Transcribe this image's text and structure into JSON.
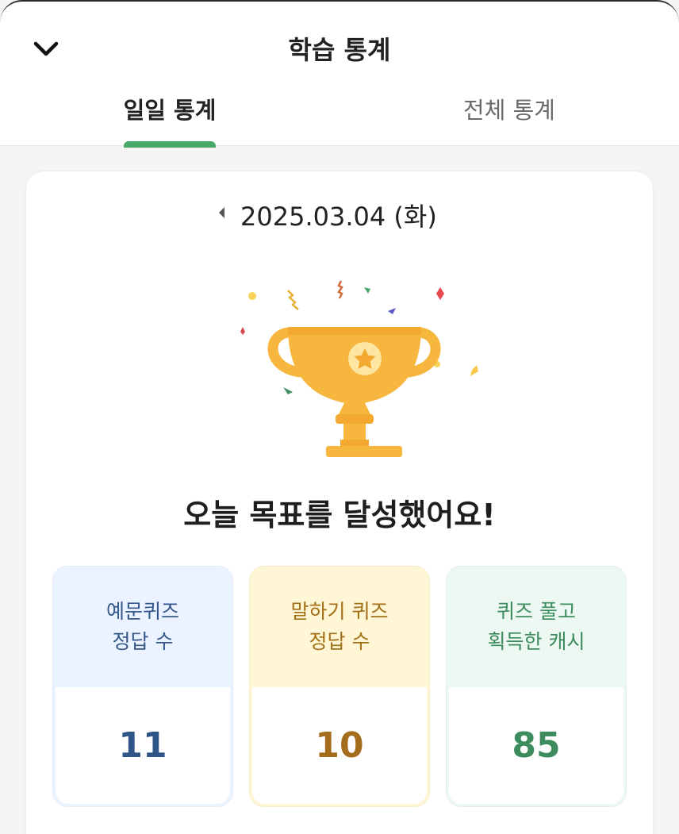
{
  "header": {
    "title": "학습 통계",
    "back_icon": "chevron-down-icon"
  },
  "tabs": [
    {
      "label": "일일 통계",
      "active": true
    },
    {
      "label": "전체 통계",
      "active": false
    }
  ],
  "colors": {
    "accent_green": "#48a86a",
    "blue_text": "#2f5486",
    "yellow_text": "#a46d1c",
    "green_text": "#3d8c5e"
  },
  "date_nav": {
    "prev_icon": "caret-left-icon",
    "date": "2025.03.04 (화)"
  },
  "achievement": {
    "icon": "trophy-icon",
    "message": "오늘 목표를 달성했어요!"
  },
  "stats": [
    {
      "label_line1": "예문퀴즈",
      "label_line2": "정답 수",
      "value": "11"
    },
    {
      "label_line1": "말하기 퀴즈",
      "label_line2": "정답 수",
      "value": "10"
    },
    {
      "label_line1": "퀴즈 풀고",
      "label_line2": "획득한 캐시",
      "value": "85"
    }
  ]
}
